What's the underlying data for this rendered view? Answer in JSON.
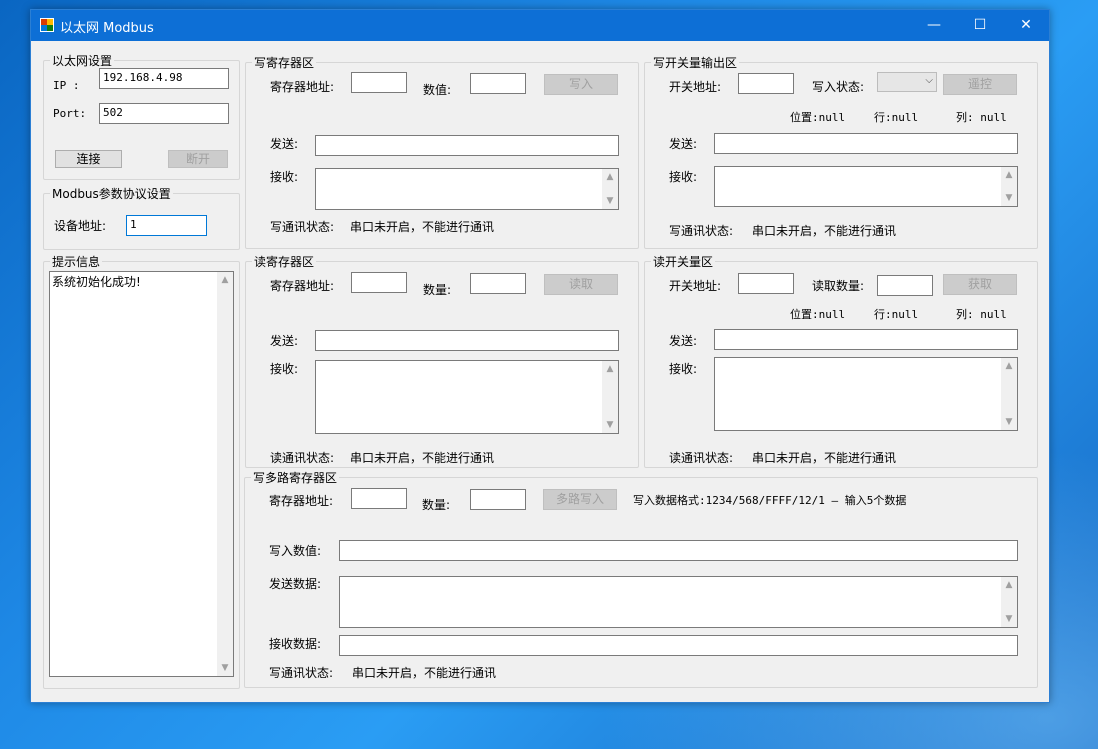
{
  "window": {
    "title": "以太网 Modbus",
    "minimize": "—",
    "maximize": "☐",
    "close": "✕"
  },
  "ethernet": {
    "legend": "以太网设置",
    "ip_label": "IP  :",
    "ip_value": "192.168.4.98",
    "port_label": "Port:",
    "port_value": "502",
    "connect": "连接",
    "disconnect": "断开"
  },
  "modbus": {
    "legend": "Modbus参数协议设置",
    "device_label": "设备地址:",
    "device_value": "1"
  },
  "info": {
    "legend": "提示信息",
    "text": "系统初始化成功!"
  },
  "write_reg": {
    "legend": "写寄存器区",
    "addr_label": "寄存器地址:",
    "value_label": "数值:",
    "button": "写入",
    "send_label": "发送:",
    "recv_label": "接收:",
    "status_label": "写通讯状态:",
    "status_text": "串口未开启，不能进行通讯"
  },
  "write_coil": {
    "legend": "写开关量输出区",
    "addr_label": "开关地址:",
    "state_label": "写入状态:",
    "button": "遥控",
    "pos": "位置:null",
    "row": "行:null",
    "col": "列: null",
    "send_label": "发送:",
    "recv_label": "接收:",
    "status_label": "写通讯状态:",
    "status_text": "串口未开启，不能进行通讯"
  },
  "read_reg": {
    "legend": "读寄存器区",
    "addr_label": "寄存器地址:",
    "qty_label": "数量:",
    "button": "读取",
    "send_label": "发送:",
    "recv_label": "接收:",
    "status_label": "读通讯状态:",
    "status_text": "串口未开启，不能进行通讯"
  },
  "read_coil": {
    "legend": "读开关量区",
    "addr_label": "开关地址:",
    "qty_label": "读取数量:",
    "button": "获取",
    "pos": "位置:null",
    "row": "行:null",
    "col": "列: null",
    "send_label": "发送:",
    "recv_label": "接收:",
    "status_label": "读通讯状态:",
    "status_text": "串口未开启，不能进行通讯"
  },
  "multi": {
    "legend": "写多路寄存器区",
    "addr_label": "寄存器地址:",
    "qty_label": "数量:",
    "button": "多路写入",
    "format": "写入数据格式:1234/568/FFFF/12/1  — 输入5个数据",
    "write_label": "写入数值:",
    "send_label": "发送数据:",
    "recv_label": "接收数据:",
    "status_label": "写通讯状态:",
    "status_text": "串口未开启，不能进行通讯"
  },
  "scroll": {
    "up": "▲",
    "down": "▼"
  }
}
